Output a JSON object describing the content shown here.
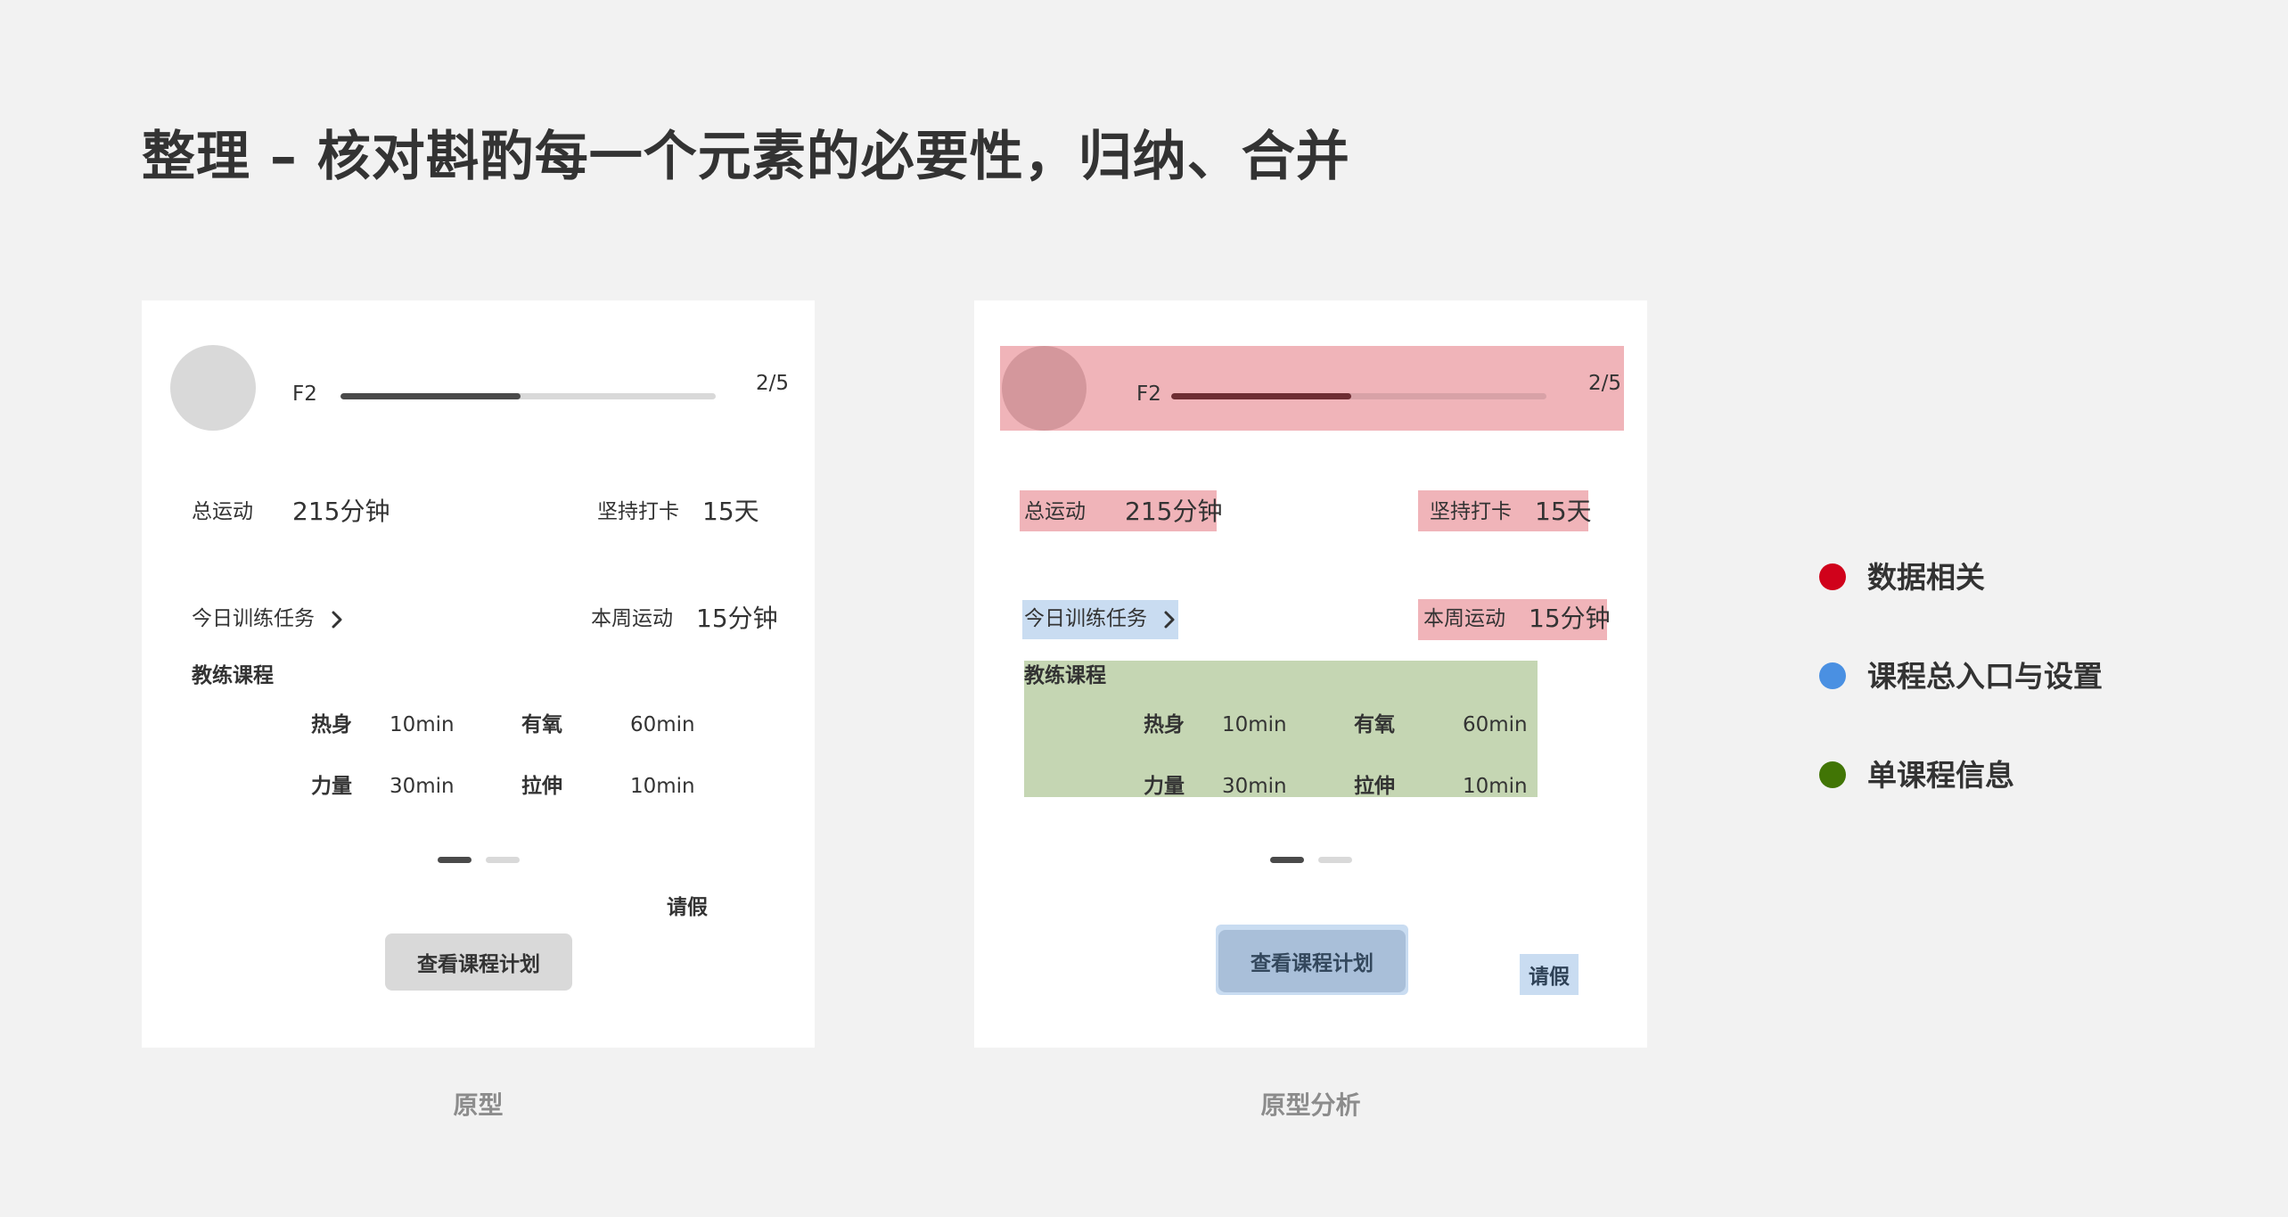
{
  "title": "整理 – 核对斟酌每一个元素的必要性，归纳、合并",
  "prototype": {
    "caption": "原型",
    "level": "F2",
    "progress_text": "2/5",
    "progress_fill": 0.48,
    "total_label": "总运动",
    "total_value": "215分钟",
    "streak_label": "坚持打卡",
    "streak_value": "15天",
    "today_task": "今日训练任务",
    "week_label": "本周运动",
    "week_value": "15分钟",
    "coach_title": "教练课程",
    "coach_items": [
      {
        "name": "热身",
        "duration": "10min"
      },
      {
        "name": "有氧",
        "duration": "60min"
      },
      {
        "name": "力量",
        "duration": "30min"
      },
      {
        "name": "拉伸",
        "duration": "10min"
      }
    ],
    "pagination": {
      "pages": 2,
      "active": 1
    },
    "leave": "请假",
    "plan_button": "查看课程计划"
  },
  "analysis": {
    "caption": "原型分析",
    "level": "F2",
    "progress_text": "2/5",
    "progress_fill": 0.48,
    "total_label": "总运动",
    "total_value": "215分钟",
    "streak_label": "坚持打卡",
    "streak_value": "15天",
    "today_task": "今日训练任务",
    "week_label": "本周运动",
    "week_value": "15分钟",
    "coach_title": "教练课程",
    "coach_items": [
      {
        "name": "热身",
        "duration": "10min"
      },
      {
        "name": "有氧",
        "duration": "60min"
      },
      {
        "name": "力量",
        "duration": "30min"
      },
      {
        "name": "拉伸",
        "duration": "10min"
      }
    ],
    "pagination": {
      "pages": 2,
      "active": 1
    },
    "leave": "请假",
    "plan_button": "查看课程计划"
  },
  "legend": [
    {
      "label": "数据相关",
      "color": "#d0021b"
    },
    {
      "label": "课程总入口与设置",
      "color": "#4a90e2"
    },
    {
      "label": "单课程信息",
      "color": "#417505"
    }
  ]
}
